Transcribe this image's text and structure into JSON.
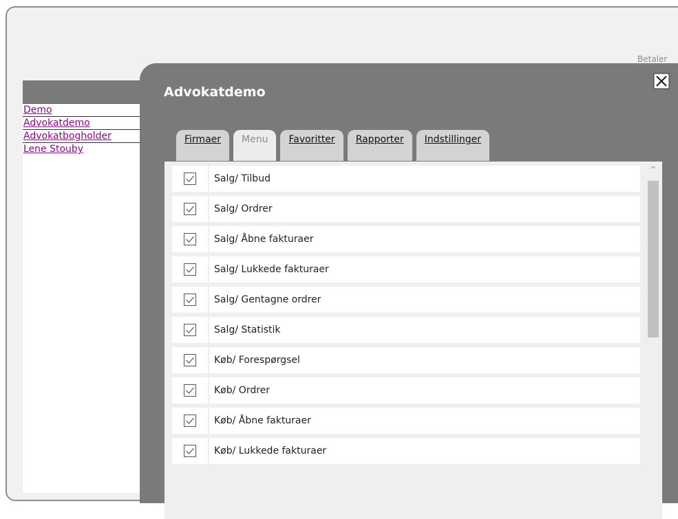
{
  "page": {
    "top_right_text": "Betaler"
  },
  "sidebar": {
    "items": [
      {
        "label": "Demo"
      },
      {
        "label": "Advokatdemo"
      },
      {
        "label": "Advokatbogholder"
      },
      {
        "label": "Lene Stouby"
      }
    ]
  },
  "modal": {
    "title": "Advokatdemo",
    "close_icon": "close-x-icon",
    "tabs": [
      {
        "label": "Firmaer",
        "active": false
      },
      {
        "label": "Menu",
        "active": true
      },
      {
        "label": "Favoritter",
        "active": false
      },
      {
        "label": "Rapporter",
        "active": false
      },
      {
        "label": "Indstillinger",
        "active": false
      }
    ],
    "rows": [
      {
        "label": "Salg/ Tilbud",
        "checked": true
      },
      {
        "label": "Salg/ Ordrer",
        "checked": true
      },
      {
        "label": "Salg/ Åbne fakturaer",
        "checked": true
      },
      {
        "label": "Salg/ Lukkede fakturaer",
        "checked": true
      },
      {
        "label": "Salg/ Gentagne ordrer",
        "checked": true
      },
      {
        "label": "Salg/ Statistik",
        "checked": true
      },
      {
        "label": "Køb/ Forespørgsel",
        "checked": true
      },
      {
        "label": "Køb/ Ordrer",
        "checked": true
      },
      {
        "label": "Køb/ Åbne fakturaer",
        "checked": true
      },
      {
        "label": "Køb/ Lukkede fakturaer",
        "checked": true
      }
    ]
  },
  "colors": {
    "modal_bg": "#7a7a7a",
    "link": "#8a0a8a",
    "tab_bg": "#d3d3d3",
    "tab_active_bg": "#ececec"
  }
}
